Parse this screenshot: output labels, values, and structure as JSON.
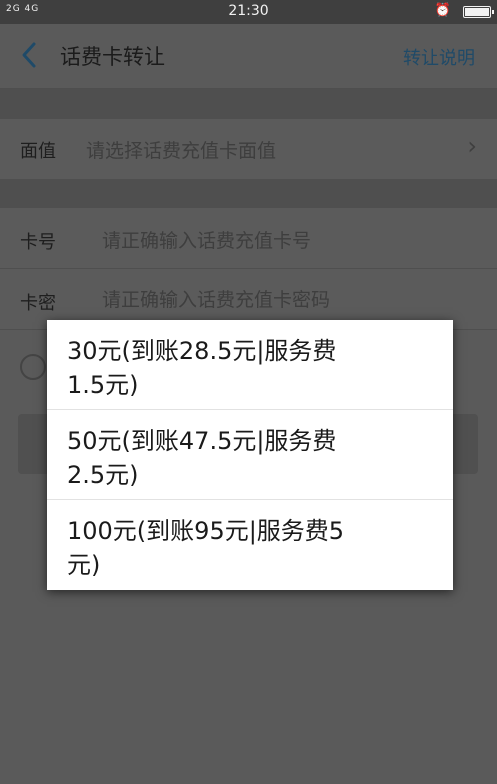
{
  "status_bar": {
    "signal_text": "2G 4G",
    "time": "21:30",
    "alarm_icon": "alarm-icon",
    "battery_icon": "battery-icon"
  },
  "header": {
    "title": "话费卡转让",
    "help_link": "转让说明"
  },
  "form": {
    "denomination_label": "面值",
    "denomination_placeholder": "请选择话费充值卡面值",
    "card_number_label": "卡号",
    "card_number_placeholder": "请正确输入话费充值卡号",
    "card_password_label": "卡密",
    "card_password_placeholder": "请正确输入话费充值卡密码"
  },
  "popup": {
    "options": [
      {
        "line1": "30元(到账28.5元|服务费",
        "line2": "1.5元)"
      },
      {
        "line1": "50元(到账47.5元|服务费",
        "line2": "2.5元)"
      },
      {
        "line1": "100元(到账95元|服务费5",
        "line2": "元)"
      }
    ]
  }
}
